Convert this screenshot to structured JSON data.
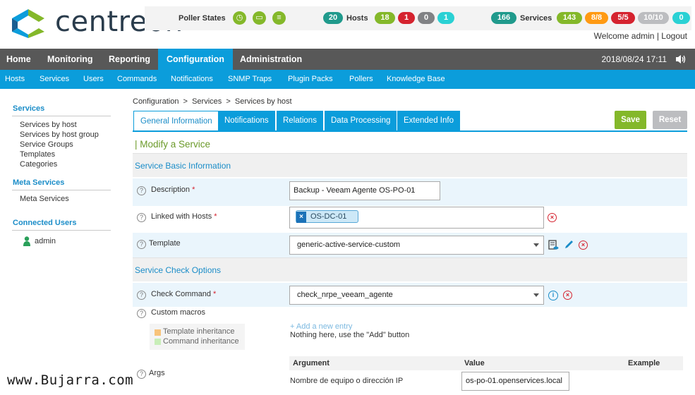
{
  "brand": {
    "name": "centreon"
  },
  "status_bar": {
    "poller_label": "Poller States",
    "hosts_label": "Hosts",
    "hosts_total": "20",
    "hosts_up": "18",
    "hosts_down": "1",
    "hosts_unreachable": "0",
    "hosts_pending": "1",
    "services_label": "Services",
    "services_total": "166",
    "services_ok": "143",
    "services_warning": "8/8",
    "services_critical": "5/5",
    "services_unknown": "10/10",
    "services_pending": "0"
  },
  "user": {
    "welcome": "Welcome admin",
    "separator": "|",
    "logout": "Logout"
  },
  "main_nav": [
    "Home",
    "Monitoring",
    "Reporting",
    "Configuration",
    "Administration"
  ],
  "datetime": "2018/08/24 17:11",
  "sub_nav": [
    "Hosts",
    "Services",
    "Users",
    "Commands",
    "Notifications",
    "SNMP Traps",
    "Plugin Packs",
    "Pollers",
    "Knowledge Base"
  ],
  "sidebar": {
    "services_head": "Services",
    "services_items": [
      "Services by host",
      "Services by host group",
      "Service Groups",
      "Templates",
      "Categories"
    ],
    "meta_head": "Meta Services",
    "meta_items": [
      "Meta Services"
    ],
    "users_head": "Connected Users",
    "users": [
      "admin"
    ]
  },
  "breadcrumb": "Configuration  >  Services  >  Services by host",
  "tabs": [
    "General Information",
    "Notifications",
    "Relations",
    "Data Processing",
    "Extended Info"
  ],
  "buttons": {
    "save": "Save",
    "reset": "Reset"
  },
  "form": {
    "title": "| Modify a Service",
    "basic_section": "Service Basic Information",
    "description_label": "Description",
    "description_value": "Backup - Veeam Agente OS-PO-01",
    "linked_hosts_label": "Linked with Hosts",
    "linked_host": "OS-DC-01",
    "template_label": "Template",
    "template_value": "generic-active-service-custom",
    "check_section": "Service Check Options",
    "check_command_label": "Check Command",
    "check_command_value": "check_nrpe_veeam_agente",
    "custom_macros_label": "Custom macros",
    "add_entry": "+ Add a new entry",
    "nothing_here": "Nothing here, use the \"Add\" button",
    "legend_template": "Template inheritance",
    "legend_command": "Command inheritance",
    "args_label": "Args",
    "args_columns": [
      "Argument",
      "Value",
      "Example"
    ],
    "args_rows": [
      {
        "argument": "Nombre de equipo o dirección IP",
        "value": "os-po-01.openservices.local"
      }
    ]
  },
  "watermark": "www.Bujarra.com",
  "colors": {
    "nav_dark": "#585858",
    "accent_blue": "#0b9ddb",
    "ok_green": "#84b82a",
    "critical_red": "#d5232f",
    "warning_orange": "#ff9a13",
    "unknown_grey": "#bcbdc0",
    "pending_cyan": "#2ad1d4"
  }
}
